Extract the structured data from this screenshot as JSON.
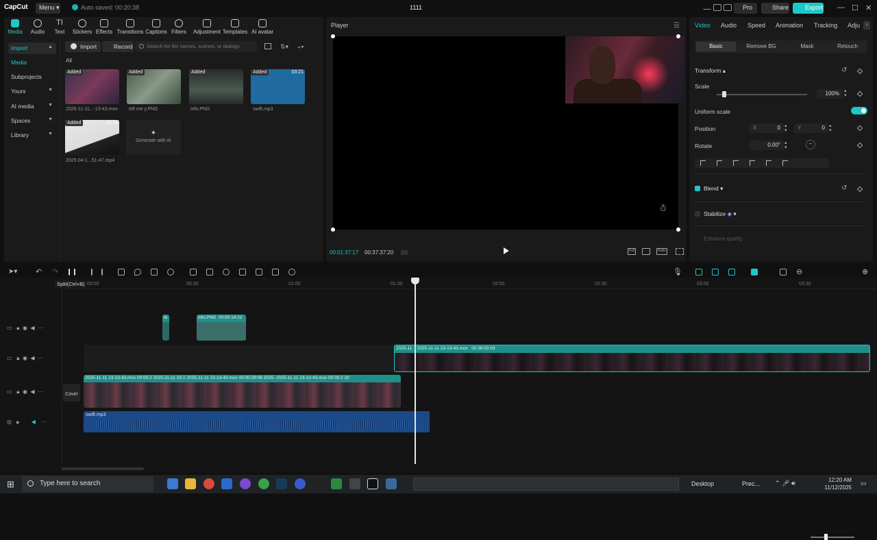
{
  "titlebar": {
    "logo": "CapCut",
    "menu_label": "Menu",
    "autosave": "Auto saved: 00:20:38",
    "project_title": "1111",
    "pro_label": "Pro",
    "share_label": "Share",
    "export_label": "Export"
  },
  "media_toolbar": [
    {
      "label": "Media",
      "active": true
    },
    {
      "label": "Audio"
    },
    {
      "label": "Text"
    },
    {
      "label": "Stickers"
    },
    {
      "label": "Effects"
    },
    {
      "label": "Transitions"
    },
    {
      "label": "Captions"
    },
    {
      "label": "Filters"
    },
    {
      "label": "Adjustment"
    },
    {
      "label": "Templates"
    },
    {
      "label": "AI avatar"
    }
  ],
  "side_nav": [
    {
      "label": "Import"
    },
    {
      "label": "Media"
    },
    {
      "label": "Subprojects"
    },
    {
      "label": "Yours"
    },
    {
      "label": "AI media"
    },
    {
      "label": "Spaces"
    },
    {
      "label": "Library"
    }
  ],
  "media": {
    "import_label": "Import",
    "record_label": "Record",
    "search_placeholder": "Search for file names, scenes, or dialogs",
    "all_label": "All",
    "added_badge": "Added",
    "items": [
      {
        "name": "2025-11-11...-13-43.mov",
        "duration": ""
      },
      {
        "name": "tell me y.PNG",
        "duration": ""
      },
      {
        "name": "info.PNG",
        "duration": ""
      },
      {
        "name": "swift.mp3",
        "duration": "03:21"
      },
      {
        "name": "2025-04-1...51-47.mp4",
        "duration": "00:10"
      }
    ],
    "generate_ai": "Generate with AI"
  },
  "player": {
    "title": "Player",
    "timecode_current": "00:01:37:17",
    "timecode_total": "00:37:37:20",
    "full_label": "Full",
    "ratio_label": "Ratio"
  },
  "inspector": {
    "tabs": [
      "Video",
      "Audio",
      "Speed",
      "Animation",
      "Tracking",
      "Adju"
    ],
    "sub_tabs": [
      "Basic",
      "Remove BG",
      "Mask",
      "Retouch"
    ],
    "transform_label": "Transform",
    "scale_label": "Scale",
    "scale_value": "100%",
    "scale_fraction": 0.06,
    "uniform_scale_label": "Uniform scale",
    "position_label": "Position",
    "x_label": "X",
    "x_value": "0",
    "y_label": "Y",
    "y_value": "0",
    "rotate_label": "Rotate",
    "rotate_value": "0.00°",
    "blend_label": "Blend",
    "stabilize_label": "Stabilize",
    "enhance_label": "Enhance quality"
  },
  "timeline": {
    "tooltip": "Split(Ctrl+B)",
    "ruler": [
      "00:00",
      "00:30",
      "01:00",
      "01:30",
      "02:00",
      "02:30",
      "03:00",
      "03:30"
    ],
    "cover_label": "Cover",
    "track1_clips": [
      {
        "label": "te"
      },
      {
        "label": "info.PNG",
        "duration": "00:00:14:22"
      }
    ],
    "track2_clip": {
      "label_a": "2025-11",
      "label_b": "2025-11-11 23-13-43.mov",
      "duration": "00:36:00:03"
    },
    "main_clips": [
      {
        "label": "2025-11-11 23-13-43.mov",
        "duration": "00:00:2"
      },
      {
        "label": "2025-11-11 23-1"
      },
      {
        "label": "2025-11-11 23-13-43.mov",
        "duration": "00:00:29:08"
      },
      {
        "label": "2025-"
      },
      {
        "label": "2025-11-11 23-13-43.mov",
        "duration": "00:00:2"
      },
      {
        "label": "20"
      }
    ],
    "audio_clip": "swift.mp3"
  },
  "taskbar": {
    "search_placeholder": "Type here to search",
    "desktop_label": "Desktop",
    "weather_label": "Prec...",
    "time": "12:20 AM",
    "date": "11/12/2025"
  },
  "colors": {
    "accent": "#1fc8c8",
    "clip_head": "#1f8f8a",
    "audio": "#1b4a88"
  }
}
